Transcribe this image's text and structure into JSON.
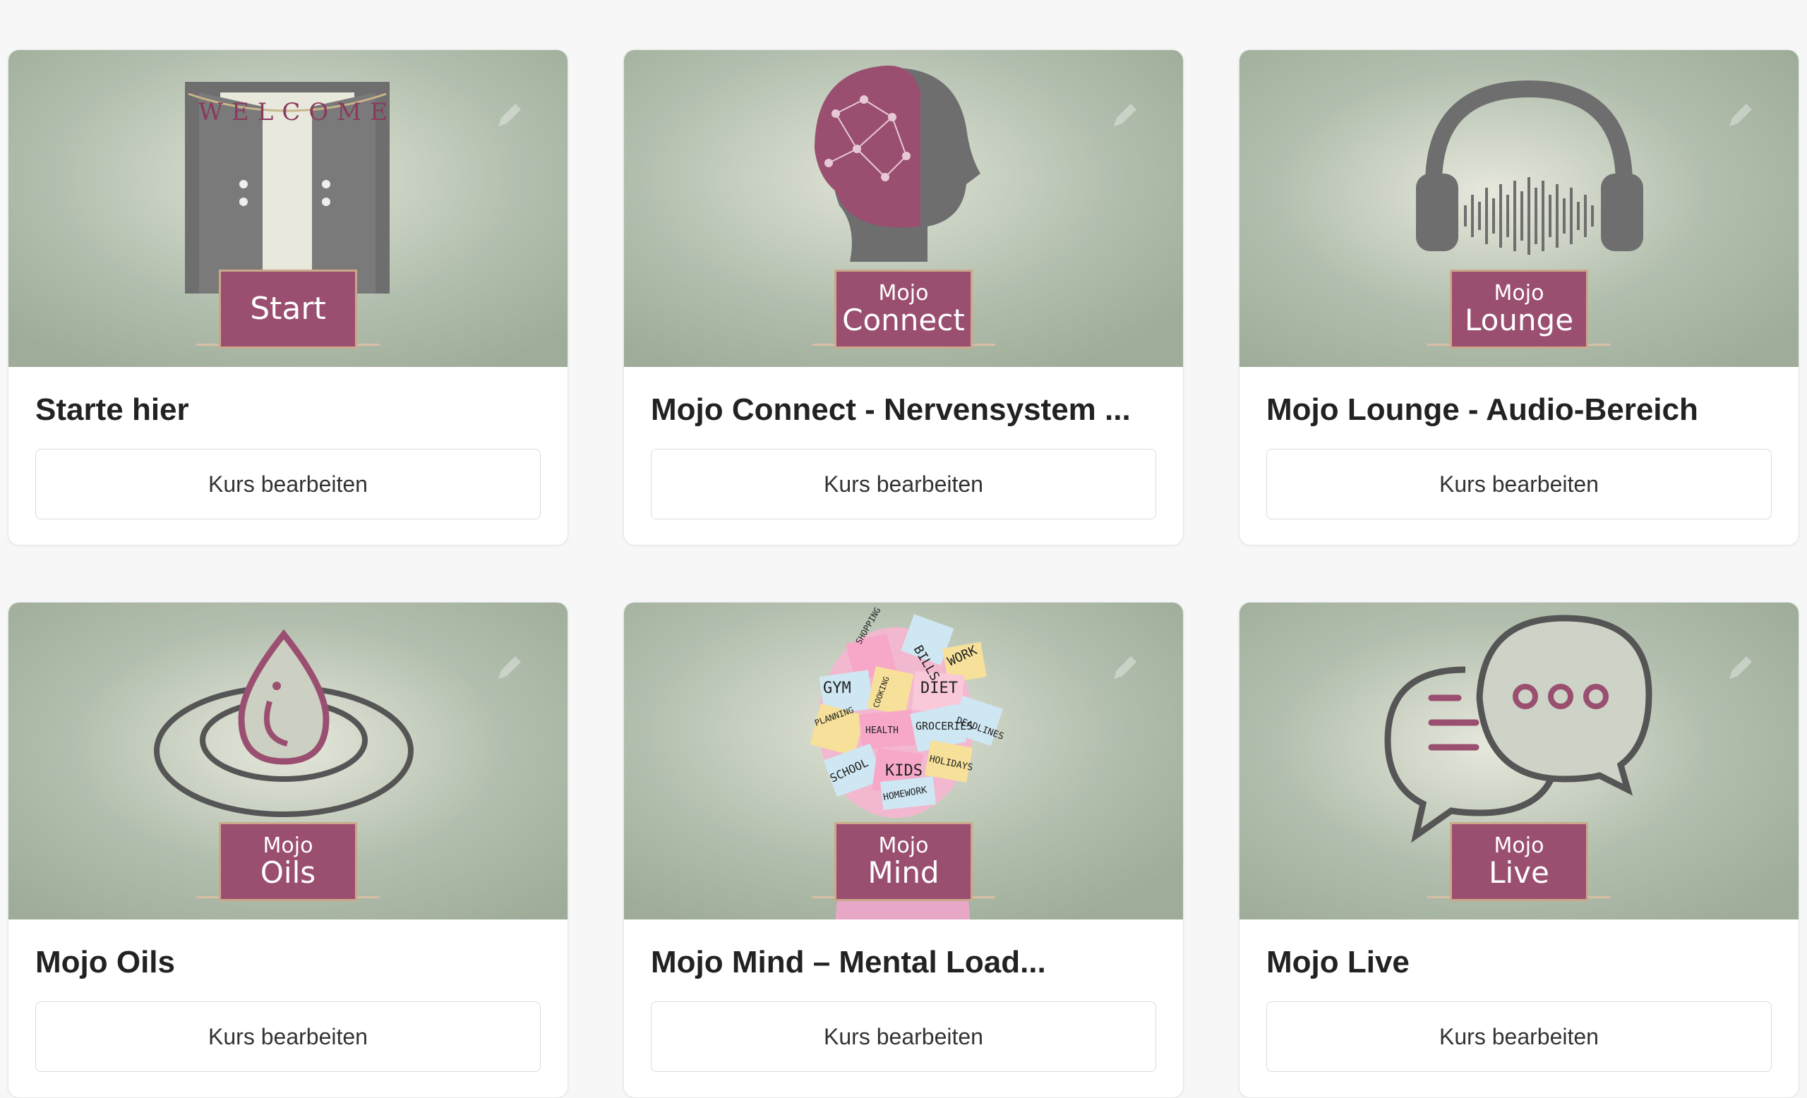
{
  "courses": [
    {
      "title": "Starte hier",
      "button": "Kurs bearbeiten",
      "badge_line1": "",
      "badge_line2": "Start",
      "banner": "WELCOME",
      "icon": "door-icon"
    },
    {
      "title": "Mojo Connect - Nervensystem ...",
      "button": "Kurs bearbeiten",
      "badge_line1": "Mojo",
      "badge_line2": "Connect",
      "icon": "head-network-icon"
    },
    {
      "title": "Mojo Lounge - Audio-Bereich",
      "button": "Kurs bearbeiten",
      "badge_line1": "Mojo",
      "badge_line2": "Lounge",
      "icon": "headphones-icon"
    },
    {
      "title": "Mojo Oils",
      "button": "Kurs bearbeiten",
      "badge_line1": "Mojo",
      "badge_line2": "Oils",
      "icon": "oil-drop-icon"
    },
    {
      "title": "Mojo Mind – Mental Load...",
      "button": "Kurs bearbeiten",
      "badge_line1": "Mojo",
      "badge_line2": "Mind",
      "icon": "sticky-notes-head-icon",
      "notes": [
        "BILLS",
        "WORK",
        "GYM",
        "DIET",
        "HEALTH",
        "GROCERIES",
        "DEADLINES",
        "SCHOOL",
        "KIDS",
        "HOLIDAYS",
        "HOMEWORK",
        "SHOPPING",
        "PLANNING",
        "COOKING"
      ]
    },
    {
      "title": "Mojo Live",
      "button": "Kurs bearbeiten",
      "badge_line1": "Mojo",
      "badge_line2": "Live",
      "icon": "chat-bubbles-icon"
    }
  ],
  "colors": {
    "accent": "#9a4f70",
    "image_bg": "#a9b7a4",
    "icon_gray": "#6e6e6e"
  }
}
